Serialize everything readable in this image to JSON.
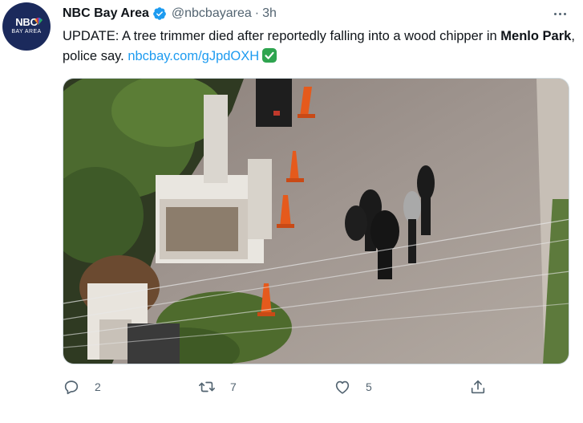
{
  "author": {
    "name": "NBC Bay Area",
    "handle": "@nbcbayarea",
    "separator": "·",
    "time": "3h",
    "avatar_text_top": "NBC",
    "avatar_text_bottom": "BAY AREA"
  },
  "tweet": {
    "text_prefix": "UPDATE: A tree trimmer died after reportedly falling into a wood chipper in ",
    "text_bold": "Menlo Park",
    "text_suffix": ", police say. ",
    "link": "nbcbay.com/gJpdOXH"
  },
  "actions": {
    "replies": "2",
    "retweets": "7",
    "likes": "5"
  },
  "colors": {
    "link": "#1d9bf0",
    "muted": "#536471",
    "verified": "#1d9bf0",
    "check_emoji": "#2ea44f"
  },
  "icons": {
    "verified": "verified-badge-icon",
    "more": "more-dots-icon",
    "check": "check-mark-icon",
    "reply": "reply-icon",
    "retweet": "retweet-icon",
    "like": "heart-icon",
    "share": "share-icon"
  }
}
